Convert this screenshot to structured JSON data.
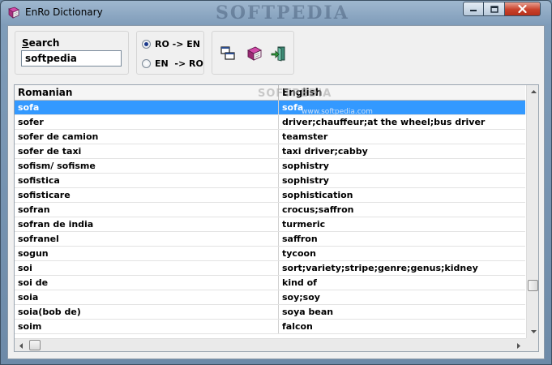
{
  "window": {
    "title": "EnRo Dictionary",
    "watermark": "SOFTPEDIA",
    "controls": {
      "minimize": "minimize",
      "maximize": "maximize",
      "close": "close"
    }
  },
  "search": {
    "label_accel": "S",
    "label_rest": "earch",
    "value": "softpedia"
  },
  "direction": {
    "options": [
      {
        "label": "RO -> EN",
        "selected": true
      },
      {
        "label": "EN  -> RO",
        "selected": false
      }
    ]
  },
  "toolbar": {
    "icons": [
      "windows-icon",
      "book-icon",
      "exit-icon"
    ]
  },
  "grid": {
    "columns": [
      "Romanian",
      "English"
    ],
    "watermark": "SOFTPEDIA",
    "watermark_sub": "www.softpedia.com",
    "rows": [
      {
        "ro": "sofa",
        "en": "sofa",
        "selected": true
      },
      {
        "ro": "sofer",
        "en": "driver;chauffeur;at the wheel;bus driver"
      },
      {
        "ro": "sofer de camion",
        "en": "teamster"
      },
      {
        "ro": "sofer de taxi",
        "en": "taxi driver;cabby"
      },
      {
        "ro": "sofism/ sofisme",
        "en": "sophistry"
      },
      {
        "ro": "sofistica",
        "en": "sophistry"
      },
      {
        "ro": "sofisticare",
        "en": "sophistication"
      },
      {
        "ro": "sofran",
        "en": "crocus;saffron"
      },
      {
        "ro": "sofran de india",
        "en": "turmeric"
      },
      {
        "ro": "sofranel",
        "en": "saffron"
      },
      {
        "ro": "sogun",
        "en": "tycoon"
      },
      {
        "ro": "soi",
        "en": "sort;variety;stripe;genre;genus;kidney"
      },
      {
        "ro": "soi de",
        "en": "kind of"
      },
      {
        "ro": "soia",
        "en": "soy;soy"
      },
      {
        "ro": "soia(bob de)",
        "en": "soya bean"
      },
      {
        "ro": "soim",
        "en": "falcon"
      }
    ]
  },
  "colors": {
    "selection": "#3399ff",
    "titlebar": "#7f9cb9",
    "close_button": "#c9412a"
  }
}
